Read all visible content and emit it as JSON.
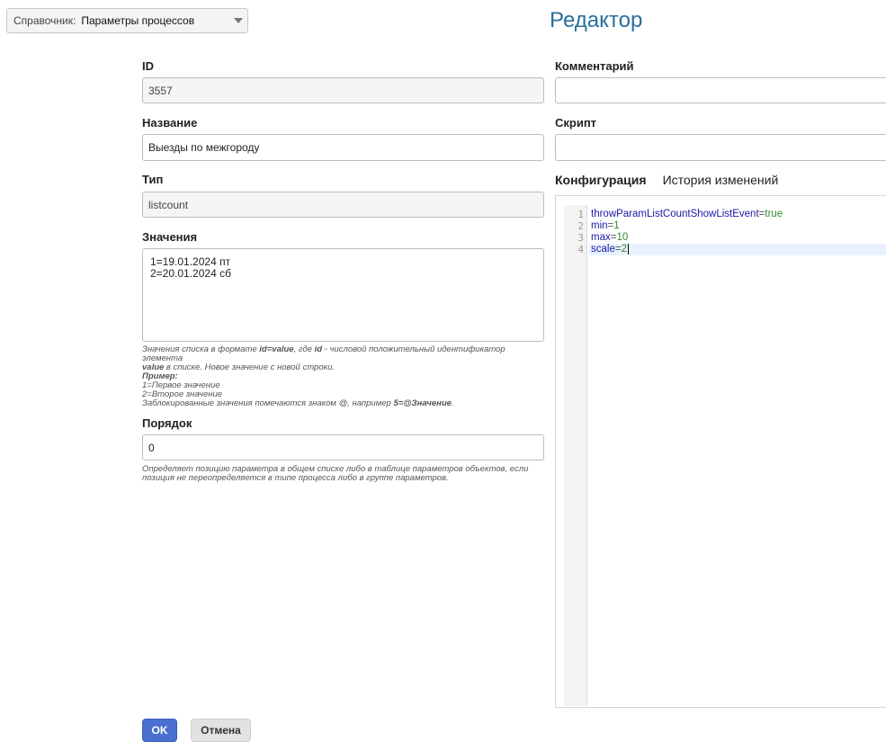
{
  "directory": {
    "label": "Справочник:",
    "value": "Параметры процессов"
  },
  "title": "Редактор",
  "form": {
    "id": {
      "label": "ID",
      "value": "3557"
    },
    "name": {
      "label": "Название",
      "value": "Выезды по межгороду"
    },
    "type": {
      "label": "Тип",
      "value": "listcount"
    },
    "values": {
      "label": "Значения",
      "lines": [
        "1=19.01.2024 пт",
        "2=20.01.2024 сб"
      ],
      "hint": {
        "p1": "Значения списка в формате ",
        "b1": "id=value",
        "p2": ", где ",
        "b2": "id",
        "p3": " - числовой положительный идентификатор элемента ",
        "b3": "value",
        "p4": " в списке. Новое значение с новой строки.",
        "example_label": "Пример:",
        "ex1": "1=Первое значение",
        "ex2": "2=Второе значение",
        "p5": "Заблокированные значения помечаются знаком @, например ",
        "b4": "5=@Значение",
        "p6": "."
      }
    },
    "order": {
      "label": "Порядок",
      "value": "0",
      "hint": "Определяет позицию параметра в общем списке либо в таблице параметров объектов, если позиция не переопределяется в типе процесса либо в группе параметров."
    },
    "comment": {
      "label": "Комментарий",
      "value": ""
    },
    "script": {
      "label": "Скрипт",
      "value": ""
    }
  },
  "tabs": [
    {
      "label": "Конфигурация",
      "active": true
    },
    {
      "label": "История изменений",
      "active": false
    }
  ],
  "editor": {
    "lines": [
      {
        "num": "1",
        "key": "throwParamListCountShowListEvent",
        "value": "true"
      },
      {
        "num": "2",
        "key": "min",
        "value": "1"
      },
      {
        "num": "3",
        "key": "max",
        "value": "10"
      },
      {
        "num": "4",
        "key": "scale",
        "value": "2"
      }
    ]
  },
  "buttons": {
    "ok": "OK",
    "cancel": "Отмена"
  }
}
